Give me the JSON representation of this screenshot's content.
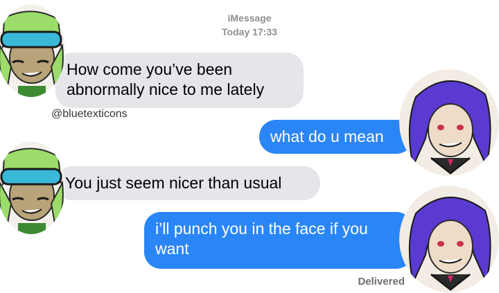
{
  "header": {
    "service": "iMessage",
    "timestamp": "Today 17:33"
  },
  "messages": [
    {
      "direction": "incoming",
      "text": "How come you’ve been abnormally nice to me lately"
    },
    {
      "direction": "outgoing",
      "text": "what do u mean"
    },
    {
      "direction": "incoming",
      "text": "You just seem nicer than usual"
    },
    {
      "direction": "outgoing",
      "text": "i’ll punch you in the face if you want"
    }
  ],
  "watermark": "@bluetexticons",
  "status": "Delivered",
  "colors": {
    "incoming_bubble": "#e5e5ea",
    "outgoing_bubble": "#2a86f6",
    "meta_text": "#8e8e93"
  },
  "avatars": [
    {
      "name": "green-haired-character-avatar",
      "side": "left"
    },
    {
      "name": "purple-haired-character-avatar",
      "side": "right"
    }
  ]
}
